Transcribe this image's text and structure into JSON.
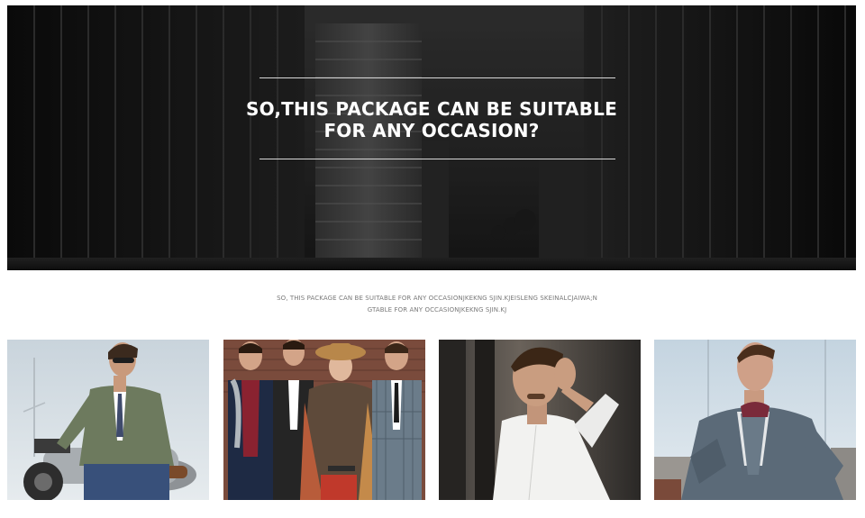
{
  "hero": {
    "title_line1": "SO,THIS PACKAGE CAN BE SUITABLE",
    "title_line2": "FOR ANY OCCASION?"
  },
  "subtitle": {
    "line1": "SO, THIS PACKAGE CAN BE SUITABLE FOR ANY OCCASIONJKEKNG SJIN.KJEISLENG SKEINALCJAIWA;N",
    "line2": "GTABLE FOR ANY OCCASIONJKEKNG SJIN.KJ"
  },
  "gallery": {
    "photos": [
      {
        "subject": "man-on-motorcycle-photo"
      },
      {
        "subject": "group-fashion-photo"
      },
      {
        "subject": "man-white-shirt-photo"
      },
      {
        "subject": "man-grey-suit-photo"
      }
    ]
  },
  "colors": {
    "hero_bg": "#1b1b1b",
    "title": "#ffffff",
    "subtitle": "#7a7a7a",
    "page_bg": "#ffffff"
  }
}
